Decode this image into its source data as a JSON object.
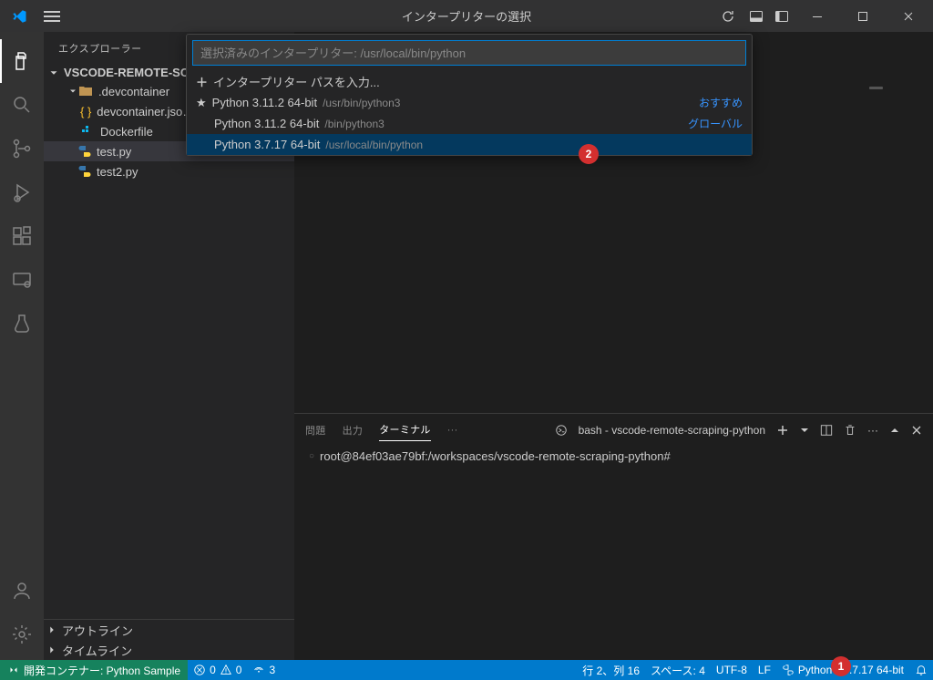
{
  "titlebar": {
    "title": "インタープリターの選択"
  },
  "sidebar": {
    "header": "エクスプローラー",
    "project": "VSCODE-REMOTE-SCR…",
    "folder": ".devcontainer",
    "files": {
      "devcontainer": "devcontainer.jso…",
      "dockerfile": "Dockerfile",
      "testpy": "test.py",
      "test2py": "test2.py"
    },
    "outline": "アウトライン",
    "timeline": "タイムライン"
  },
  "quickpick": {
    "placeholder": "選択済みのインタープリター: /usr/local/bin/python",
    "enter_path": "インタープリター パスを入力...",
    "items": [
      {
        "label": "Python 3.11.2 64-bit",
        "path": "/usr/bin/python3",
        "tag": "おすすめ"
      },
      {
        "label": "Python 3.11.2 64-bit",
        "path": "/bin/python3",
        "tag": "グローバル"
      },
      {
        "label": "Python 3.7.17 64-bit",
        "path": "/usr/local/bin/python",
        "tag": ""
      }
    ]
  },
  "panel": {
    "tabs": {
      "problems": "問題",
      "output": "出力",
      "terminal": "ターミナル"
    },
    "terminal_name": "bash - vscode-remote-scraping-python",
    "prompt": "root@84ef03ae79bf:/workspaces/vscode-remote-scraping-python#"
  },
  "statusbar": {
    "remote": "開発コンテナー: Python Sample",
    "errors": "0",
    "warnings": "0",
    "ports": "3",
    "cursor": "行 2、列 16",
    "spaces": "スペース: 4",
    "encoding": "UTF-8",
    "eol": "LF",
    "lang": "Python",
    "interp": "3.7.17 64-bit"
  },
  "badges": {
    "one": "1",
    "two": "2"
  }
}
